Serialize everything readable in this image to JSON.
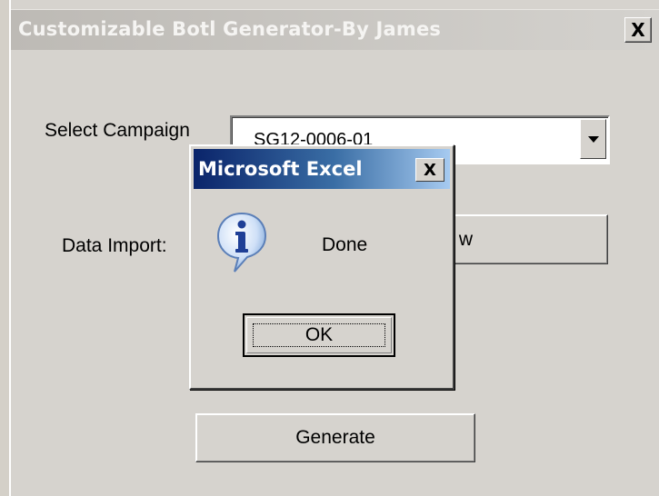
{
  "form": {
    "title": "Customizable Botl Generator-By James",
    "close_glyph": "X",
    "campaign_label": "Select Campaign",
    "campaign_value": "SG12-0006-01",
    "import_label": "Data Import:",
    "import_button_partial": "w",
    "generate_label": "Generate"
  },
  "msgbox": {
    "title": "Microsoft Excel",
    "close_glyph": "X",
    "icon": "info-icon",
    "message": "Done",
    "ok_label": "OK"
  }
}
